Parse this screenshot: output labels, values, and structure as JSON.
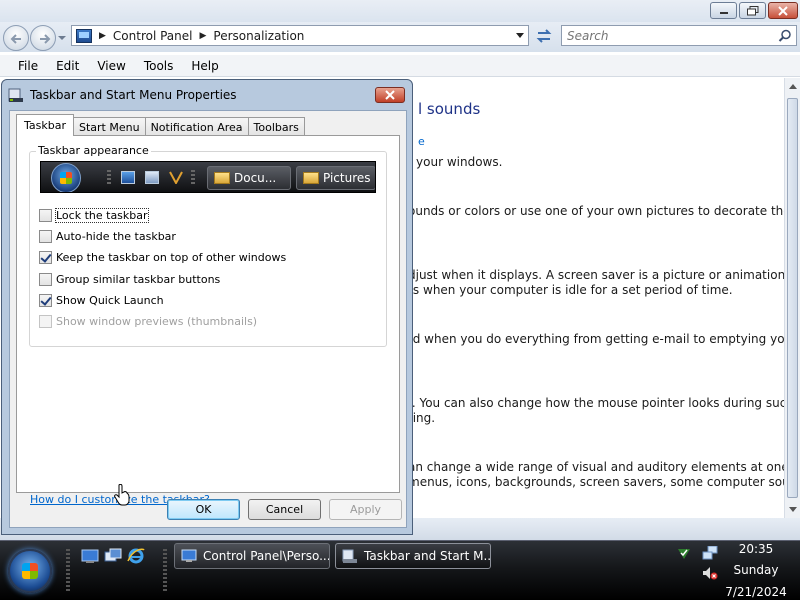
{
  "address_bar": {
    "crumbs": [
      "Control Panel",
      "Personalization"
    ],
    "search_placeholder": "Search"
  },
  "menu": {
    "items": [
      {
        "label": "File"
      },
      {
        "label": "Edit"
      },
      {
        "label": "View"
      },
      {
        "label": "Tools"
      },
      {
        "label": "Help"
      }
    ]
  },
  "content": {
    "heading": "l sounds",
    "link": "e",
    "lines": [
      "f your windows.",
      "ounds or colors or use one of your own pictures to decorate the",
      "djust when it displays. A screen saver is a picture or animation that",
      "rs when your computer is idle for a set period of time.",
      "rd when you do everything from getting e-mail to emptying your",
      "r. You can also change how the mouse pointer looks during such",
      "ting.",
      "an change a wide range of visual and auditory elements at one time",
      "menus, icons, backgrounds, screen savers, some computer sounds,"
    ]
  },
  "dialog": {
    "title": "Taskbar and Start Menu Properties",
    "tabs": [
      "Taskbar",
      "Start Menu",
      "Notification Area",
      "Toolbars"
    ],
    "group_label": "Taskbar appearance",
    "preview_buttons": [
      "Docu...",
      "Pictures"
    ],
    "options": [
      {
        "label": "Lock the taskbar",
        "checked": false
      },
      {
        "label": "Auto-hide the taskbar",
        "checked": false
      },
      {
        "label": "Keep the taskbar on top of other windows",
        "checked": true
      },
      {
        "label": "Group similar taskbar buttons",
        "checked": false
      },
      {
        "label": "Show Quick Launch",
        "checked": true
      },
      {
        "label": "Show window previews (thumbnails)",
        "checked": false
      }
    ],
    "help_link": "How do I customize the taskbar?",
    "buttons": {
      "ok": "OK",
      "cancel": "Cancel",
      "apply": "Apply"
    }
  },
  "taskbar": {
    "tasks": [
      "Control Panel\\Perso...",
      "Taskbar and Start M..."
    ],
    "clock": {
      "time": "20:35",
      "day": "Sunday",
      "date": "7/21/2024"
    }
  },
  "colors": {
    "accent_link": "#0066cc",
    "heading": "#1e3287",
    "taskbar": "#15171a"
  }
}
